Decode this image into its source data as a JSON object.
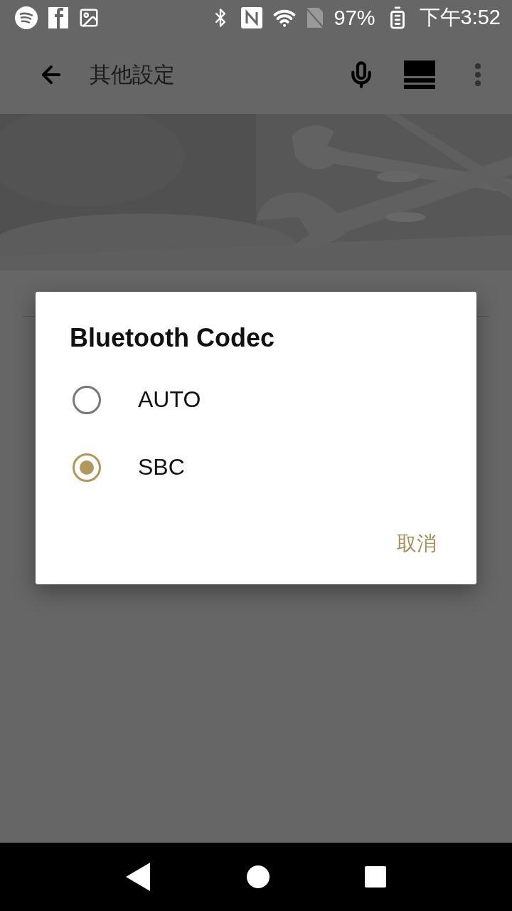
{
  "status_bar": {
    "battery": "97%",
    "time": "下午3:52"
  },
  "toolbar": {
    "title": "其他設定"
  },
  "dialog": {
    "title": "Bluetooth Codec",
    "options": [
      {
        "label": "AUTO",
        "selected": false
      },
      {
        "label": "SBC",
        "selected": true
      }
    ],
    "buttons": [
      "取消"
    ]
  }
}
